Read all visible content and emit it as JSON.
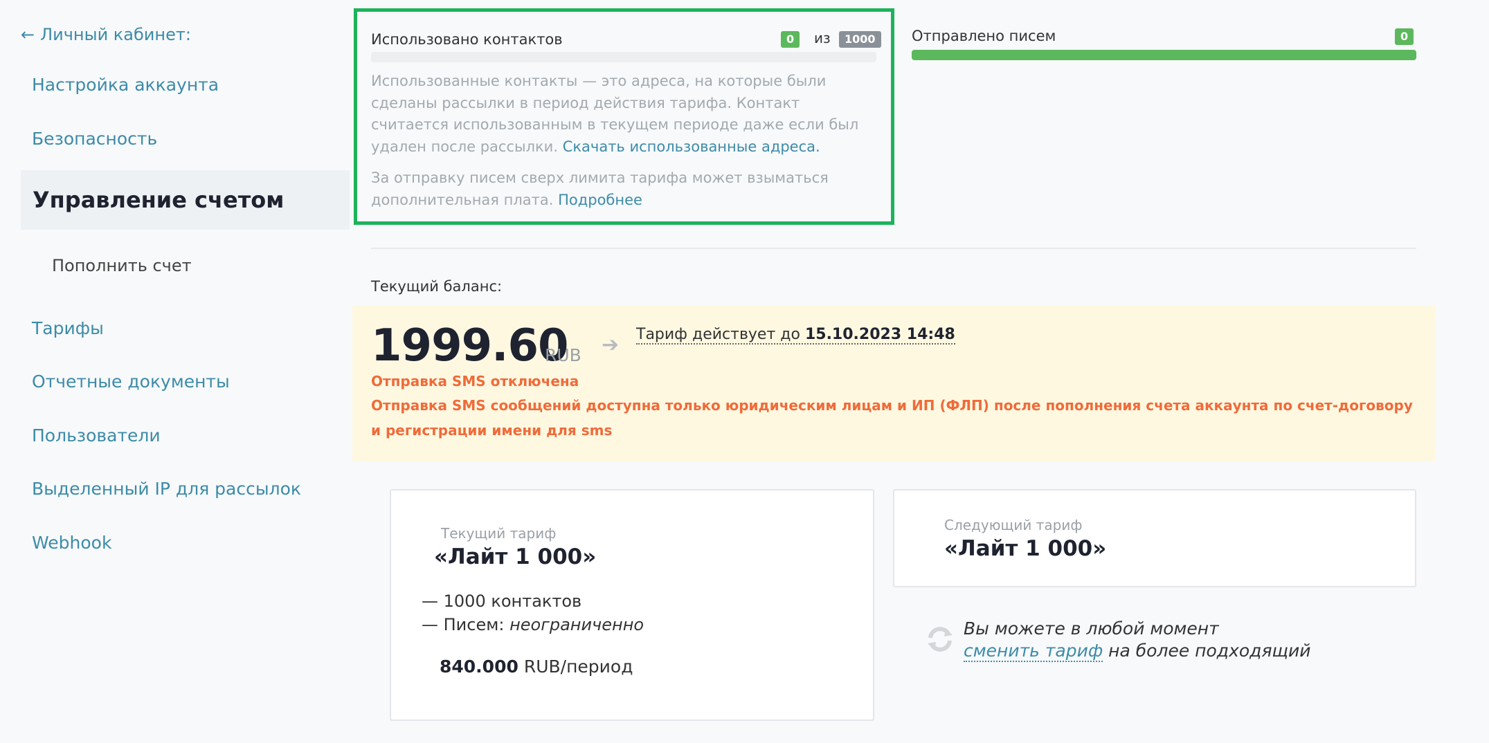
{
  "sidebar": {
    "back_label": "Личный кабинет:",
    "items": [
      {
        "label": "Настройка аккаунта"
      },
      {
        "label": "Безопасность"
      }
    ],
    "active": "Управление счетом",
    "sub_item": "Пополнить счет",
    "items_after": [
      {
        "label": "Тарифы"
      },
      {
        "label": "Отчетные документы"
      },
      {
        "label": "Пользователи"
      },
      {
        "label": "Выделенный IP для рассылок"
      },
      {
        "label": "Webhook"
      }
    ]
  },
  "contacts": {
    "title": "Использовано контактов",
    "used": "0",
    "of_label": "из",
    "limit": "1000",
    "progress": 0,
    "help_text": "Использованные контакты — это адреса, на которые были сделаны рассылки в период действия тарифа. Контакт считается использованным в текущем периоде даже если был удален после рассылки.",
    "help_link": "Скачать использованные адреса.",
    "extra_text": "За отправку писем сверх лимита тарифа может взыматься дополнительная плата.",
    "extra_link": "Подробнее"
  },
  "emails": {
    "title": "Отправлено писем",
    "count": "0",
    "progress": 1
  },
  "balance": {
    "label": "Текущий баланс:",
    "amount": "1999.60",
    "currency": "RUB",
    "valid_prefix": "Тариф действует до",
    "valid_date": "15.10.2023 14:48",
    "sms_off": "Отправка SMS отключена",
    "sms_info": "Отправка SMS сообщений доступна только юридическим лицам и ИП (ФЛП) после пополнения счета аккаунта по счет-договору и регистрации имени для sms"
  },
  "current_tariff": {
    "label": "Текущий тариф",
    "name": "«Лайт 1 000»",
    "contacts_line": "— 1000 контактов",
    "letters_prefix": "— Писем:",
    "letters_value": "неограниченно",
    "price_value": "840.000",
    "price_unit": "RUB/период"
  },
  "next_tariff": {
    "label": "Следующий тариф",
    "name": "«Лайт 1 000»"
  },
  "change_note": {
    "line1": "Вы можете в любой момент",
    "link": "сменить тариф",
    "line2_rest": "на более подходящий"
  },
  "colors": {
    "accent": "#3d8ba8",
    "highlight_border": "#1db35a",
    "badge_green": "#5cb85c",
    "warning": "#ef6b3a",
    "balance_bg": "#fff8e1"
  }
}
